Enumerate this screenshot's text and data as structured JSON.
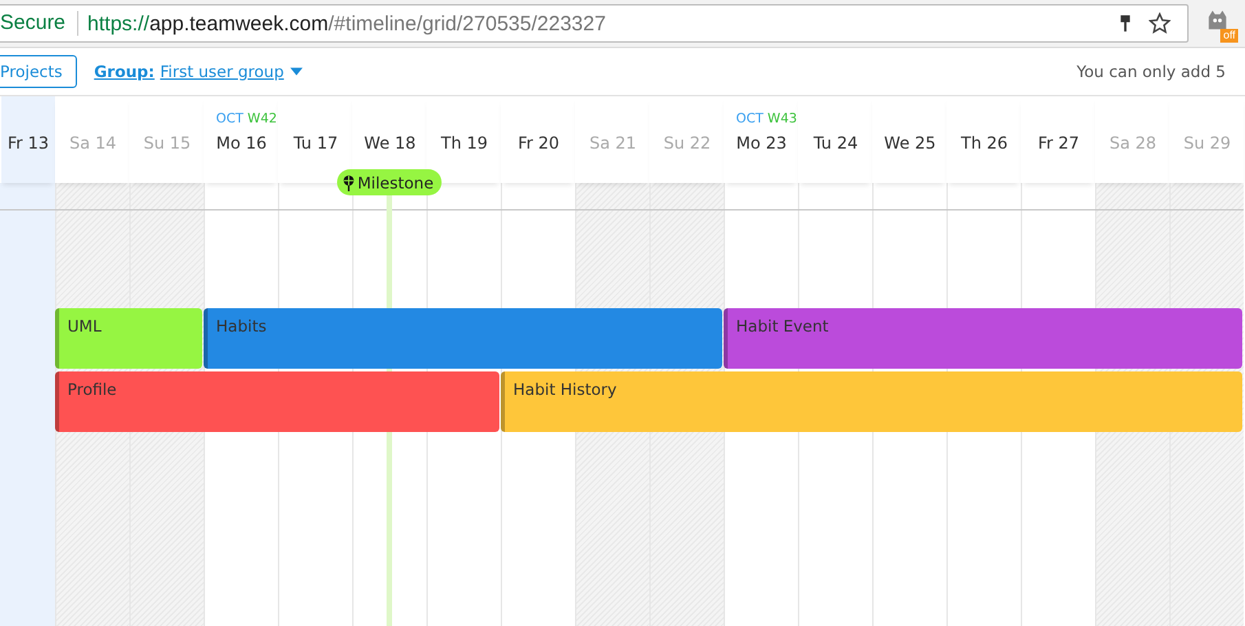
{
  "browser": {
    "security": "Secure",
    "url_parts": [
      "https://",
      "app.teamweek.com",
      "/#timeline/grid/270535/223327"
    ],
    "extension_badge": "off"
  },
  "toolbar": {
    "projects_button": "Projects",
    "group_label": "Group:",
    "group_value": "First user group",
    "notice": "You can only add 5"
  },
  "days": [
    {
      "label": "Fr 13",
      "weekend": false,
      "today": true
    },
    {
      "label": "Sa 14",
      "weekend": true,
      "today": false
    },
    {
      "label": "Su 15",
      "weekend": true,
      "today": false
    },
    {
      "label": "Mo 16",
      "weekend": false,
      "today": false,
      "month": "OCT",
      "week": "W42"
    },
    {
      "label": "Tu 17",
      "weekend": false,
      "today": false
    },
    {
      "label": "We 18",
      "weekend": false,
      "today": false
    },
    {
      "label": "Th 19",
      "weekend": false,
      "today": false
    },
    {
      "label": "Fr 20",
      "weekend": false,
      "today": false
    },
    {
      "label": "Sa 21",
      "weekend": true,
      "today": false
    },
    {
      "label": "Su 22",
      "weekend": true,
      "today": false
    },
    {
      "label": "Mo 23",
      "weekend": false,
      "today": false,
      "month": "OCT",
      "week": "W43"
    },
    {
      "label": "Tu 24",
      "weekend": false,
      "today": false
    },
    {
      "label": "We 25",
      "weekend": false,
      "today": false
    },
    {
      "label": "Th 26",
      "weekend": false,
      "today": false
    },
    {
      "label": "Fr 27",
      "weekend": false,
      "today": false
    },
    {
      "label": "Sa 28",
      "weekend": true,
      "today": false
    },
    {
      "label": "Su 29",
      "weekend": true,
      "today": false
    }
  ],
  "milestone": {
    "label": "Milestone"
  },
  "task_rows": [
    [
      {
        "name": "UML",
        "color": "#96f542"
      },
      {
        "name": "Habits",
        "color": "#2389e3"
      },
      {
        "name": "Habit Event",
        "color": "#bb4bdb"
      }
    ],
    [
      {
        "name": "Profile",
        "color": "#fe5252"
      },
      {
        "name": "Habit History",
        "color": "#fec63a"
      }
    ]
  ]
}
